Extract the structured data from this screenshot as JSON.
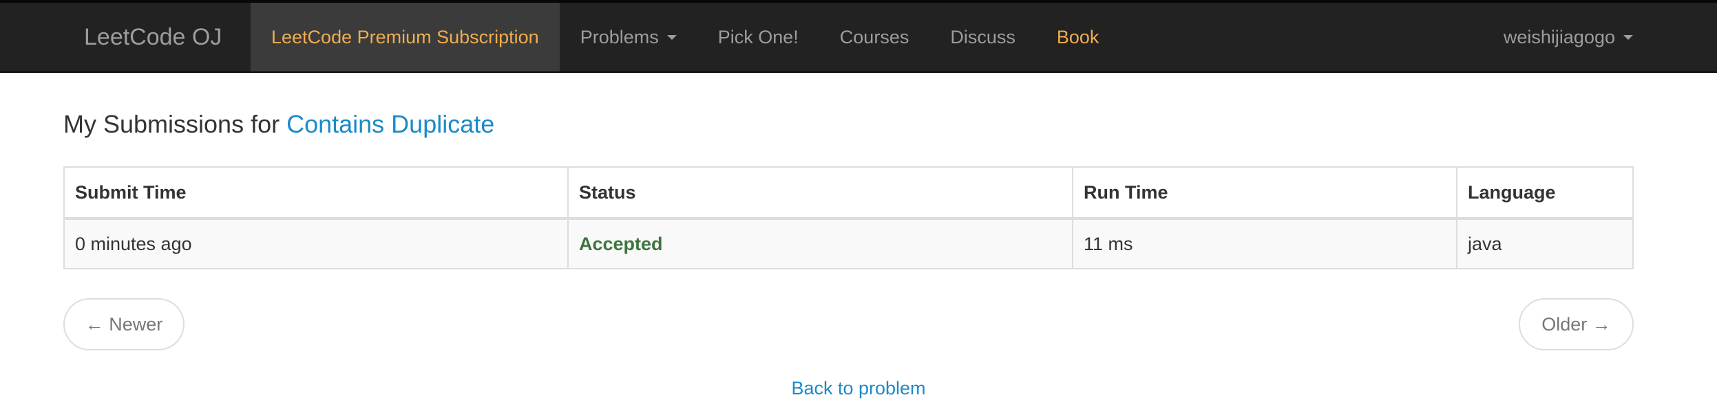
{
  "navbar": {
    "brand": "LeetCode OJ",
    "items": [
      {
        "label": "LeetCode Premium Subscription"
      },
      {
        "label": "Problems"
      },
      {
        "label": "Pick One!"
      },
      {
        "label": "Courses"
      },
      {
        "label": "Discuss"
      },
      {
        "label": "Book"
      }
    ],
    "user": "weishijiagogo"
  },
  "header": {
    "prefix": "My Submissions for ",
    "problem": "Contains Duplicate"
  },
  "table": {
    "columns": [
      "Submit Time",
      "Status",
      "Run Time",
      "Language"
    ],
    "rows": [
      {
        "submit_time": "0 minutes ago",
        "status": "Accepted",
        "run_time": "11 ms",
        "language": "java"
      }
    ]
  },
  "pager": {
    "newer": "← Newer",
    "older": "Older →"
  },
  "back_link": "Back to problem",
  "colors": {
    "navbar_bg": "#222222",
    "accent_orange": "#f0ad4e",
    "link_blue": "#1a8ac8",
    "accepted_green": "#3c763d"
  }
}
